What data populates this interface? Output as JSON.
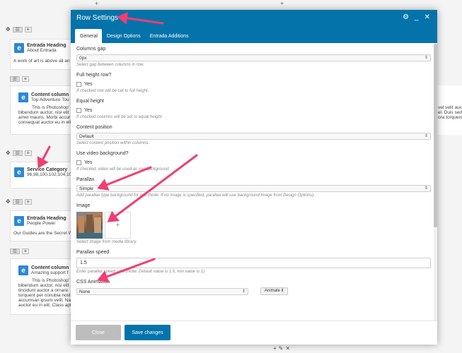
{
  "colors": {
    "accent": "#0473aa",
    "arrow": "#f03e72",
    "element_icon": "#2d88d8",
    "add_green": "#7ab04b"
  },
  "background": {
    "elements": [
      {
        "title": "Entrada Heading",
        "subtitle": "About Entrada"
      },
      {
        "title": "Content column",
        "subtitle": "Top Adventure Tou"
      },
      {
        "title": "Service Category",
        "subtitle": "96,98,100,102,104,10"
      },
      {
        "title": "Entrada Heading",
        "subtitle": "People Power"
      },
      {
        "title": "Content column",
        "subtitle": "Amazing support f"
      }
    ],
    "texts": {
      "about": "A work of art is above all an",
      "col1_l1": "This is Photoshop'",
      "col1_l2": "bibendum auctor, nisi elit",
      "col1_l3": "amet mauris. Morbi accur",
      "col1_l4": "consequat auctor eu in elit",
      "guides": "Our Guides are the Secret W",
      "col2_l1": "This is Photoshop'",
      "col2_l2": "bibendum auctor, nisi elit",
      "col2_l3": "tincidunt auctor a ornare",
      "col2_l4": "torquent per conubia nost",
      "col2_l5": "accumsan ipsum velit. Na",
      "col2_l6": "auctor eu in elit. Class aptent tacit so",
      "right_l1": "vel velit auctor",
      "right_l2": "el. Duis sed oc",
      "right_l3": "ora torquent"
    }
  },
  "modal": {
    "title": "Row Settings",
    "icons": [
      "gear-icon",
      "minimize-icon",
      "close-icon"
    ],
    "tabs": [
      {
        "label": "General",
        "active": true
      },
      {
        "label": "Design Options",
        "active": false
      },
      {
        "label": "Entrada Additions",
        "active": false
      }
    ],
    "fields": {
      "columns_gap": {
        "label": "Columns gap",
        "value": "0px",
        "hint": "Select gap between columns in row."
      },
      "full_height": {
        "label": "Full height row?",
        "option": "Yes",
        "hint": "If checked row will be set to full height."
      },
      "equal_height": {
        "label": "Equal height",
        "option": "Yes",
        "hint": "If checked columns will be set to equal height."
      },
      "content_position": {
        "label": "Content position",
        "value": "Default",
        "hint": "Select content position within columns."
      },
      "video_bg": {
        "label": "Use video background?",
        "option": "Yes",
        "hint": "If checked, video will be used as row background."
      },
      "parallax": {
        "label": "Parallax",
        "value": "Simple",
        "hint": "Add parallax type background for row (Note: If no image is specified, parallax will use background image from Design Options)."
      },
      "image": {
        "label": "Image",
        "hint": "Select image from media library."
      },
      "parallax_speed": {
        "label": "Parallax speed",
        "value": "1.5",
        "hint": "Enter parallax speed ratio (Note: Default value is 1.5, min value is 1)"
      },
      "css_animation": {
        "label": "CSS Animation",
        "value": "None",
        "button": "Animate it"
      }
    },
    "footer": {
      "close": "Close",
      "save": "Save changes"
    }
  }
}
